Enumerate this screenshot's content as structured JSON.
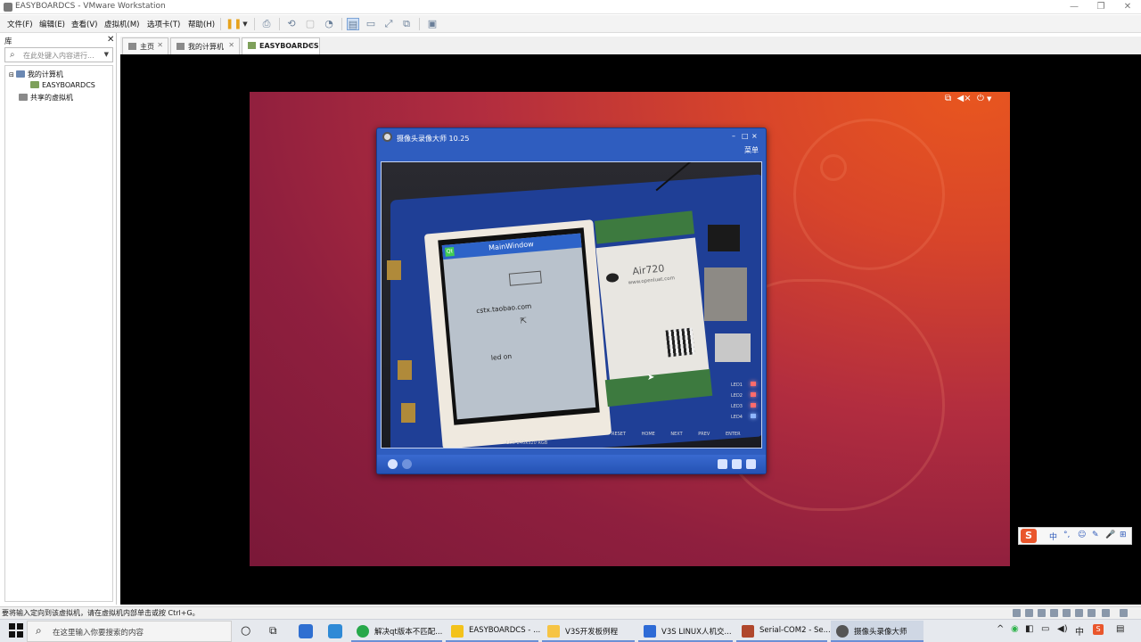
{
  "window": {
    "title": "EASYBOARDCS - VMware Workstation",
    "controls": [
      "—",
      "❐",
      "✕"
    ]
  },
  "menu": {
    "items": [
      "文件(F)",
      "编辑(E)",
      "查看(V)",
      "虚拟机(M)",
      "选项卡(T)",
      "帮助(H)"
    ]
  },
  "library": {
    "title": "库",
    "close": "✕",
    "search_placeholder": "在此处键入内容进行...",
    "tree": {
      "my_computer": "我的计算机",
      "vm": "EASYBOARDCS",
      "shared": "共享的虚拟机"
    }
  },
  "tabs": [
    {
      "label": "主页",
      "close": "✕"
    },
    {
      "label": "我的计算机",
      "close": "✕"
    },
    {
      "label": "EASYBOARDCS",
      "close": "✕"
    }
  ],
  "guest": {
    "camera_window": {
      "title": "摄像头录像大师  10.25",
      "menu": "菜单",
      "controls": [
        "–",
        "□",
        "×"
      ],
      "screen": {
        "window_title": "MainWindow",
        "text1": "cstx.taobao.com",
        "text2": "led on",
        "qt_icon": "Qt"
      },
      "board": {
        "module_title": "Air720",
        "module_url": "www.openluat.com",
        "leds": [
          "LED1",
          "LED2",
          "LED3",
          "LED4"
        ],
        "buttons": [
          "RESET",
          "HOME",
          "NEXT",
          "PREV",
          "ENTER"
        ],
        "lcd_label": "LCD  240x320  RGB"
      }
    }
  },
  "status_bar": {
    "text": "要将输入定向到该虚拟机，请在虚拟机内部单击或按 Ctrl+G。"
  },
  "taskbar": {
    "search_placeholder": "在这里输入你要搜索的内容",
    "apps": [
      {
        "label": "解决qt版本不匹配...",
        "color": "#27a84a"
      },
      {
        "label": "EASYBOARDCS - ...",
        "color": "#f3c21b"
      },
      {
        "label": "V3S开发板例程",
        "color": "#f6c445"
      },
      {
        "label": "V3S LINUX人机交...",
        "color": "#2e6bd6"
      },
      {
        "label": "Serial-COM2 - Se...",
        "color": "#b0472c"
      },
      {
        "label": "摄像头录像大师",
        "color": "#555"
      }
    ],
    "tray": {
      "ime": "中",
      "caret": "^",
      "s_label": "S"
    }
  },
  "ime_bar": {
    "logo": "S",
    "items": [
      "中",
      "°,",
      "☺",
      "✎",
      "🎤",
      "⊞"
    ]
  }
}
